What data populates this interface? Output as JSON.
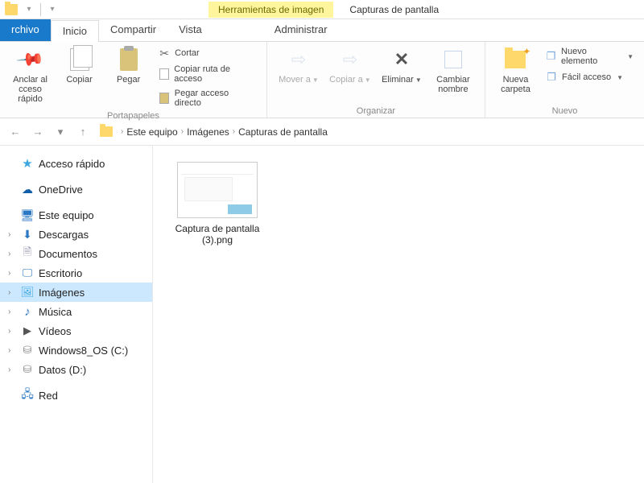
{
  "title_bar": {
    "context_tab": "Herramientas de imagen",
    "window_title": "Capturas de pantalla"
  },
  "tabs": {
    "file": "rchivo",
    "home": "Inicio",
    "share": "Compartir",
    "view": "Vista",
    "manage": "Administrar"
  },
  "ribbon": {
    "pin": {
      "label": "Anclar al cceso rápido"
    },
    "copy": {
      "label": "Copiar"
    },
    "paste": {
      "label": "Pegar"
    },
    "cut": "Cortar",
    "copy_path": "Copiar ruta de acceso",
    "paste_shortcut": "Pegar acceso directo",
    "clipboard_group": "Portapapeles",
    "move": {
      "label": "Mover a"
    },
    "copy_to": {
      "label": "Copiar a"
    },
    "delete": {
      "label": "Eliminar"
    },
    "rename": {
      "label": "Cambiar nombre"
    },
    "organize_group": "Organizar",
    "new_folder": {
      "label": "Nueva carpeta"
    },
    "new_item": "Nuevo elemento",
    "easy_access": "Fácil acceso",
    "new_group": "Nuevo"
  },
  "breadcrumb": {
    "root": "Este equipo",
    "mid": "Imágenes",
    "leaf": "Capturas de pantalla"
  },
  "nav": {
    "quick": "Acceso rápido",
    "onedrive": "OneDrive",
    "thispc": "Este equipo",
    "downloads": "Descargas",
    "documents": "Documentos",
    "desktop": "Escritorio",
    "pictures": "Imágenes",
    "music": "Música",
    "videos": "Vídeos",
    "osdisk": "Windows8_OS (C:)",
    "datadisk": "Datos (D:)",
    "network": "Red"
  },
  "files": [
    {
      "name": "Captura de pantalla (3).png"
    }
  ]
}
